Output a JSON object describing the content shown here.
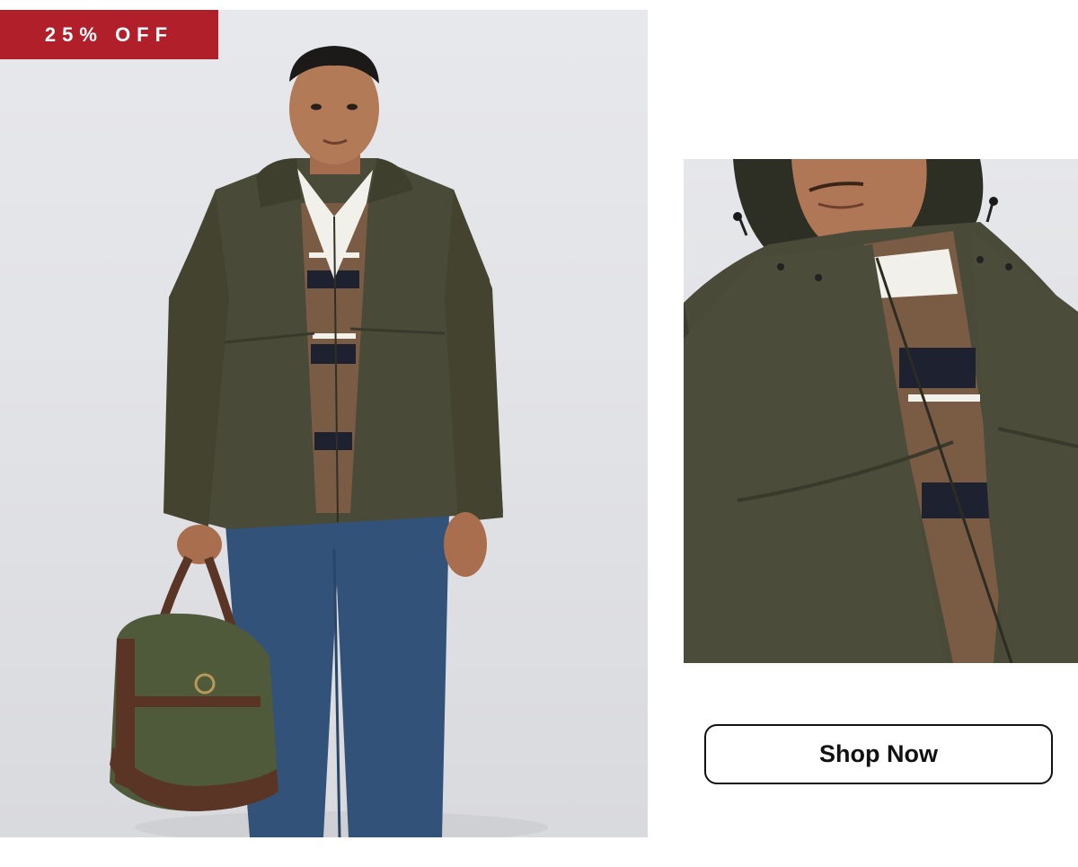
{
  "promo": {
    "badge_text": "25% OFF",
    "badge_color": "#b1202a"
  },
  "images": {
    "main": "man-in-olive-hooded-jacket-with-duffel-bag",
    "detail": "close-up-olive-jacket-hood-and-rugby-shirt"
  },
  "cta": {
    "label": "Shop Now"
  },
  "colors": {
    "jacket": "#4a4a38",
    "shirt_brown": "#7a5c45",
    "shirt_navy": "#1e2230",
    "jeans": "#33527a",
    "bag_canvas": "#4e5a3a",
    "leather": "#5a3424"
  }
}
